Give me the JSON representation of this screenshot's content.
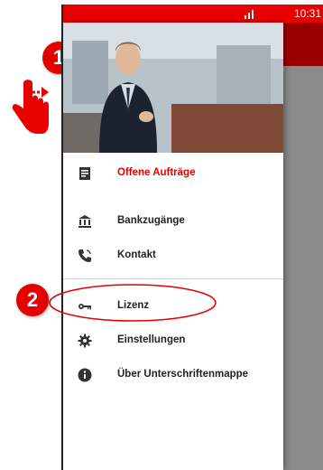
{
  "status_bar": {
    "time": "10:31"
  },
  "menu": {
    "items": [
      {
        "label": "Offene Aufträge",
        "icon": "document-icon",
        "active": true
      },
      {
        "label": "Bankzugänge",
        "icon": "bank-icon"
      },
      {
        "label": "Kontakt",
        "icon": "phone-icon"
      },
      {
        "label": "Lizenz",
        "icon": "key-icon"
      },
      {
        "label": "Einstellungen",
        "icon": "gear-icon"
      },
      {
        "label": "Über Unterschriftenmappe",
        "icon": "info-icon"
      }
    ]
  },
  "annotations": {
    "step1": "1",
    "step2": "2"
  },
  "colors": {
    "accent": "#e60000"
  }
}
